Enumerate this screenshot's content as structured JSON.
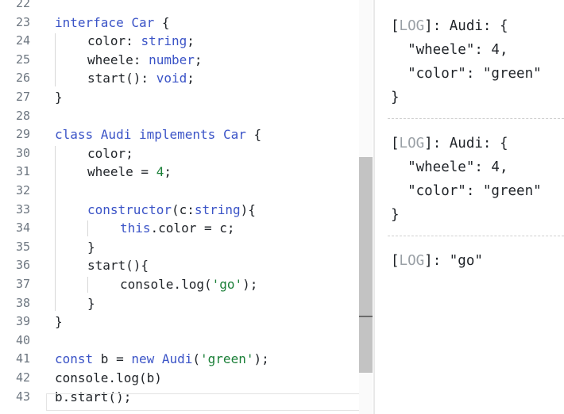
{
  "editor": {
    "lines": [
      {
        "n": "22",
        "tokens": []
      },
      {
        "n": "23",
        "tokens": [
          {
            "t": "interface ",
            "c": "kw"
          },
          {
            "t": "Car",
            "c": "ty"
          },
          {
            "t": " {",
            "c": ""
          }
        ]
      },
      {
        "n": "24",
        "indent": 1,
        "tokens": [
          {
            "t": "color: ",
            "c": ""
          },
          {
            "t": "string",
            "c": "ty"
          },
          {
            "t": ";",
            "c": ""
          }
        ]
      },
      {
        "n": "25",
        "indent": 1,
        "tokens": [
          {
            "t": "wheele: ",
            "c": ""
          },
          {
            "t": "number",
            "c": "ty"
          },
          {
            "t": ";",
            "c": ""
          }
        ]
      },
      {
        "n": "26",
        "indent": 1,
        "tokens": [
          {
            "t": "start(): ",
            "c": ""
          },
          {
            "t": "void",
            "c": "ty"
          },
          {
            "t": ";",
            "c": ""
          }
        ]
      },
      {
        "n": "27",
        "tokens": [
          {
            "t": "}",
            "c": ""
          }
        ]
      },
      {
        "n": "28",
        "tokens": []
      },
      {
        "n": "29",
        "tokens": [
          {
            "t": "class ",
            "c": "kw"
          },
          {
            "t": "Audi ",
            "c": "ty"
          },
          {
            "t": "implements ",
            "c": "kw"
          },
          {
            "t": "Car",
            "c": "ty"
          },
          {
            "t": " {",
            "c": ""
          }
        ]
      },
      {
        "n": "30",
        "indent": 1,
        "tokens": [
          {
            "t": "color;",
            "c": ""
          }
        ]
      },
      {
        "n": "31",
        "indent": 1,
        "tokens": [
          {
            "t": "wheele = ",
            "c": ""
          },
          {
            "t": "4",
            "c": "num"
          },
          {
            "t": ";",
            "c": ""
          }
        ]
      },
      {
        "n": "32",
        "tokens": []
      },
      {
        "n": "33",
        "indent": 1,
        "tokens": [
          {
            "t": "constructor",
            "c": "kw"
          },
          {
            "t": "(c:",
            "c": ""
          },
          {
            "t": "string",
            "c": "ty"
          },
          {
            "t": "){",
            "c": ""
          }
        ]
      },
      {
        "n": "34",
        "indent": 2,
        "tokens": [
          {
            "t": "this",
            "c": "kw"
          },
          {
            "t": ".color = c;",
            "c": ""
          }
        ]
      },
      {
        "n": "35",
        "indent": 1,
        "tokens": [
          {
            "t": "}",
            "c": ""
          }
        ]
      },
      {
        "n": "36",
        "indent": 1,
        "tokens": [
          {
            "t": "start(){",
            "c": ""
          }
        ]
      },
      {
        "n": "37",
        "indent": 2,
        "tokens": [
          {
            "t": "console.log(",
            "c": ""
          },
          {
            "t": "'go'",
            "c": "str"
          },
          {
            "t": ");",
            "c": ""
          }
        ]
      },
      {
        "n": "38",
        "indent": 1,
        "tokens": [
          {
            "t": "}",
            "c": ""
          }
        ]
      },
      {
        "n": "39",
        "tokens": [
          {
            "t": "}",
            "c": ""
          }
        ]
      },
      {
        "n": "40",
        "tokens": []
      },
      {
        "n": "41",
        "tokens": [
          {
            "t": "const ",
            "c": "kw"
          },
          {
            "t": "b = ",
            "c": ""
          },
          {
            "t": "new ",
            "c": "kw"
          },
          {
            "t": "Audi",
            "c": "ty"
          },
          {
            "t": "(",
            "c": ""
          },
          {
            "t": "'green'",
            "c": "str"
          },
          {
            "t": ");",
            "c": ""
          }
        ]
      },
      {
        "n": "42",
        "tokens": [
          {
            "t": "console.log(b)",
            "c": ""
          }
        ]
      },
      {
        "n": "43",
        "tokens": [
          {
            "t": "b.start();",
            "c": ""
          }
        ]
      }
    ]
  },
  "console": {
    "log_tag": "LOG",
    "entries": [
      {
        "lines": [
          "Audi: {",
          "  \"wheele\": 4,",
          "  \"color\": \"green\"",
          "}"
        ]
      },
      {
        "lines": [
          "Audi: {",
          "  \"wheele\": 4,",
          "  \"color\": \"green\"",
          "}"
        ]
      },
      {
        "lines": [
          "\"go\""
        ]
      }
    ]
  }
}
